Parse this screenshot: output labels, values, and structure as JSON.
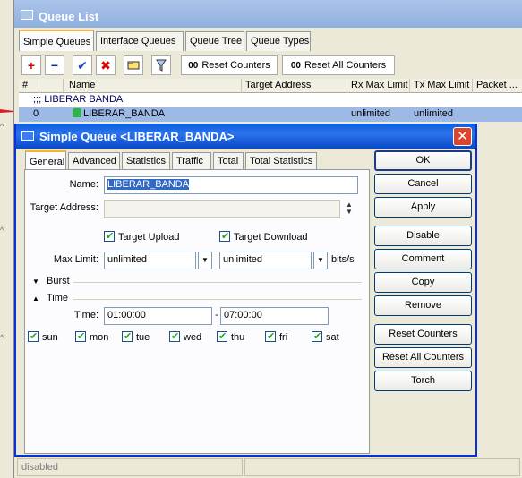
{
  "queue_list": {
    "title": "Queue List",
    "tabs": [
      "Simple Queues",
      "Interface Queues",
      "Queue Tree",
      "Queue Types"
    ],
    "toolbar": {
      "add": "+",
      "remove": "−",
      "enable": "✔",
      "disable": "✖",
      "reset_counters": "Reset Counters",
      "reset_all_counters": "Reset All Counters",
      "counter_prefix": "00"
    },
    "columns": [
      "#",
      "Name",
      "Target Address",
      "Rx Max Limit",
      "Tx Max Limit",
      "Packet ..."
    ],
    "comment_row": ";;; LIBERAR BANDA",
    "rows": [
      {
        "num": "0",
        "name": "LIBERAR_BANDA",
        "target": "",
        "rx": "unlimited",
        "tx": "unlimited",
        "packet": ""
      }
    ],
    "status": "disabled"
  },
  "dialog": {
    "title": "Simple Queue <LIBERAR_BANDA>",
    "close": "✕",
    "tabs": [
      "General",
      "Advanced",
      "Statistics",
      "Traffic",
      "Total",
      "Total Statistics"
    ],
    "name_label": "Name:",
    "name_value": "LIBERAR_BANDA",
    "target_label": "Target Address:",
    "target_value": "",
    "target_upload": "Target Upload",
    "target_download": "Target Download",
    "max_limit_label": "Max Limit:",
    "max_limit_up": "unlimited",
    "max_limit_down": "unlimited",
    "max_limit_unit": "bits/s",
    "burst": "Burst",
    "time_section": "Time",
    "time_label": "Time:",
    "time_from": "01:00:00",
    "time_sep": "-",
    "time_to": "07:00:00",
    "days": [
      "sun",
      "mon",
      "tue",
      "wed",
      "thu",
      "fri",
      "sat"
    ],
    "buttons": [
      "OK",
      "Cancel",
      "Apply",
      "Disable",
      "Comment",
      "Copy",
      "Remove",
      "Reset Counters",
      "Reset All Counters",
      "Torch"
    ]
  },
  "colors": {
    "accent": "#0a5ede",
    "selected_row": "#9dbae6",
    "arrow": "#d42020"
  }
}
